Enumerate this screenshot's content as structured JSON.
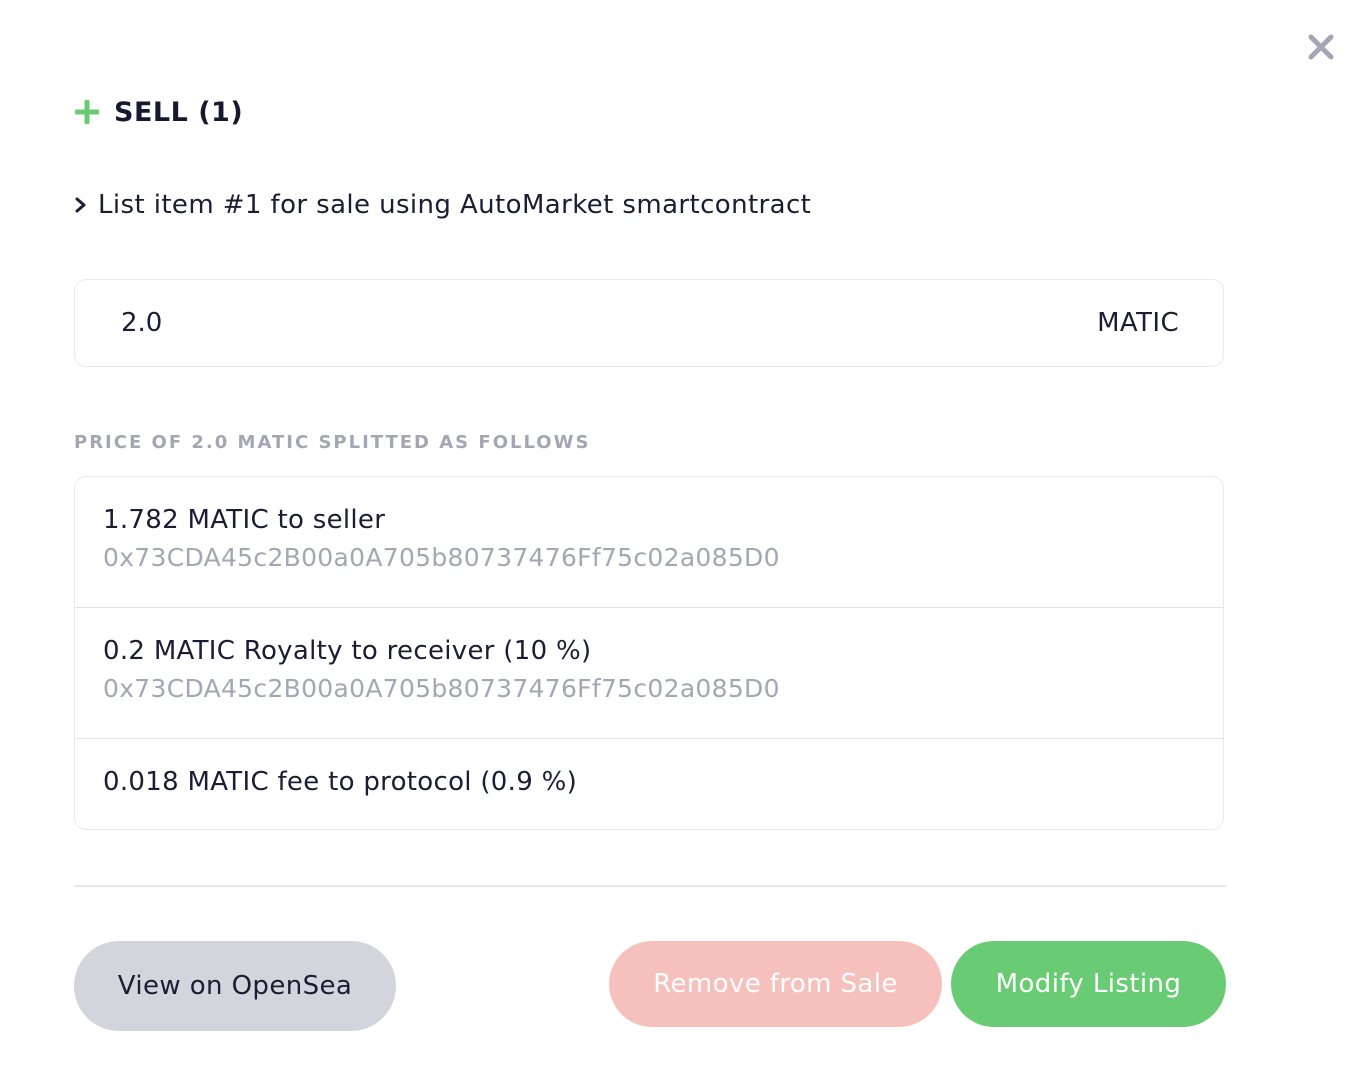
{
  "modal": {
    "close_icon": "close-icon",
    "header": {
      "icon": "plus-icon",
      "icon_color": "#69cc74",
      "title": "SELL (1)"
    },
    "subtitle": {
      "icon": "chevron-right-icon",
      "text": "List item #1 for sale using AutoMarket smartcontract"
    },
    "price": {
      "value": "2.0",
      "currency": "MATIC"
    },
    "split": {
      "heading": "PRICE OF 2.0 MATIC SPLITTED AS FOLLOWS",
      "rows": [
        {
          "label": "1.782 MATIC to seller",
          "address": "0x73CDA45c2B00a0A705b80737476Ff75c02a085D0"
        },
        {
          "label": "0.2 MATIC Royalty to receiver (10 %)",
          "address": "0x73CDA45c2B00a0A705b80737476Ff75c02a085D0"
        },
        {
          "label": "0.018 MATIC fee to protocol (0.9 %)"
        }
      ]
    },
    "actions": {
      "view_opensea": "View on OpenSea",
      "remove_from_sale": "Remove from Sale",
      "modify_listing": "Modify Listing"
    },
    "colors": {
      "accent_green": "#69cc74",
      "remove_pink": "#f6c1bd",
      "secondary_gray": "#d4d5dc",
      "muted_text": "#a4a6b3"
    }
  }
}
